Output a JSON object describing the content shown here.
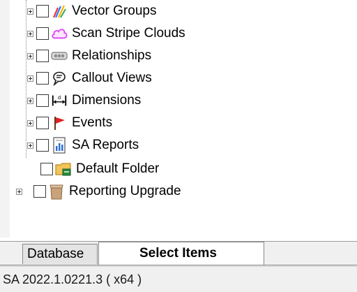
{
  "tree": {
    "items": [
      {
        "label": "Vector Groups",
        "icon": "vector-groups-icon"
      },
      {
        "label": "Scan Stripe Clouds",
        "icon": "cloud-icon"
      },
      {
        "label": "Relationships",
        "icon": "relationships-icon"
      },
      {
        "label": "Callout Views",
        "icon": "callout-views-icon"
      },
      {
        "label": "Dimensions",
        "icon": "dimensions-icon"
      },
      {
        "label": "Events",
        "icon": "events-flag-icon"
      },
      {
        "label": "SA Reports",
        "icon": "sa-reports-icon"
      },
      {
        "label": "Default Folder",
        "icon": "default-folder-icon"
      },
      {
        "label": "Reporting Upgrade",
        "icon": "reporting-upgrade-icon"
      }
    ]
  },
  "tabs": [
    {
      "label": "Database",
      "active": false
    },
    {
      "label": "Select Items",
      "active": true
    }
  ],
  "status": {
    "version": "SA 2022.1.0221.3 ( x64 )"
  },
  "colors": {
    "panel_background": "#f0f0f0",
    "tree_background": "#ffffff",
    "cloud_magenta": "#e040fb",
    "flag_red": "#e02020"
  }
}
